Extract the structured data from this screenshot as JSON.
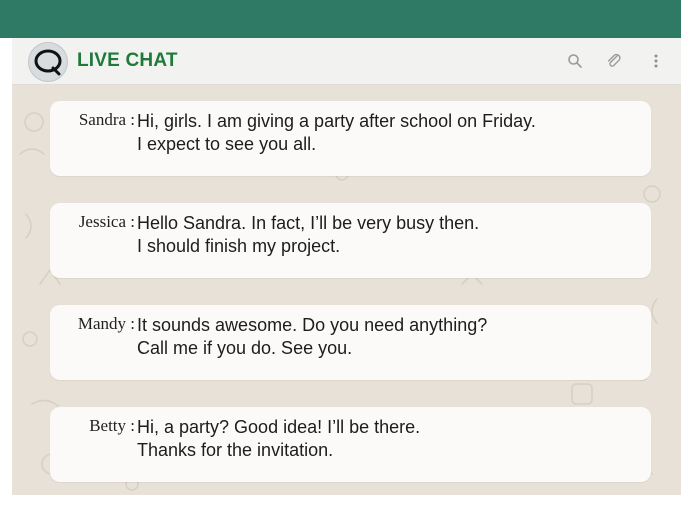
{
  "header": {
    "title": "LIVE CHAT",
    "logo_letter": "Q"
  },
  "icons": {
    "search": "search-icon",
    "attach": "paperclip-icon",
    "menu": "more-vertical-icon"
  },
  "colors": {
    "topbar": "#2e7a64",
    "title": "#1f7a3a",
    "chat_background": "#e7e1d7",
    "bubble": "#fbfaf8"
  },
  "messages": [
    {
      "speaker": "Sandra :",
      "line1": "Hi, girls. I am giving a party after school on Friday.",
      "line2": "I expect to see you all."
    },
    {
      "speaker": "Jessica :",
      "line1": "Hello Sandra. In fact, I’ll be very busy then.",
      "line2": "I should finish my project."
    },
    {
      "speaker": "Mandy :",
      "line1": "It sounds awesome. Do you need anything?",
      "line2": "Call me if you do. See you."
    },
    {
      "speaker": "Betty :",
      "line1": "Hi, a party? Good idea! I’ll be there.",
      "line2": "Thanks for the invitation."
    }
  ]
}
